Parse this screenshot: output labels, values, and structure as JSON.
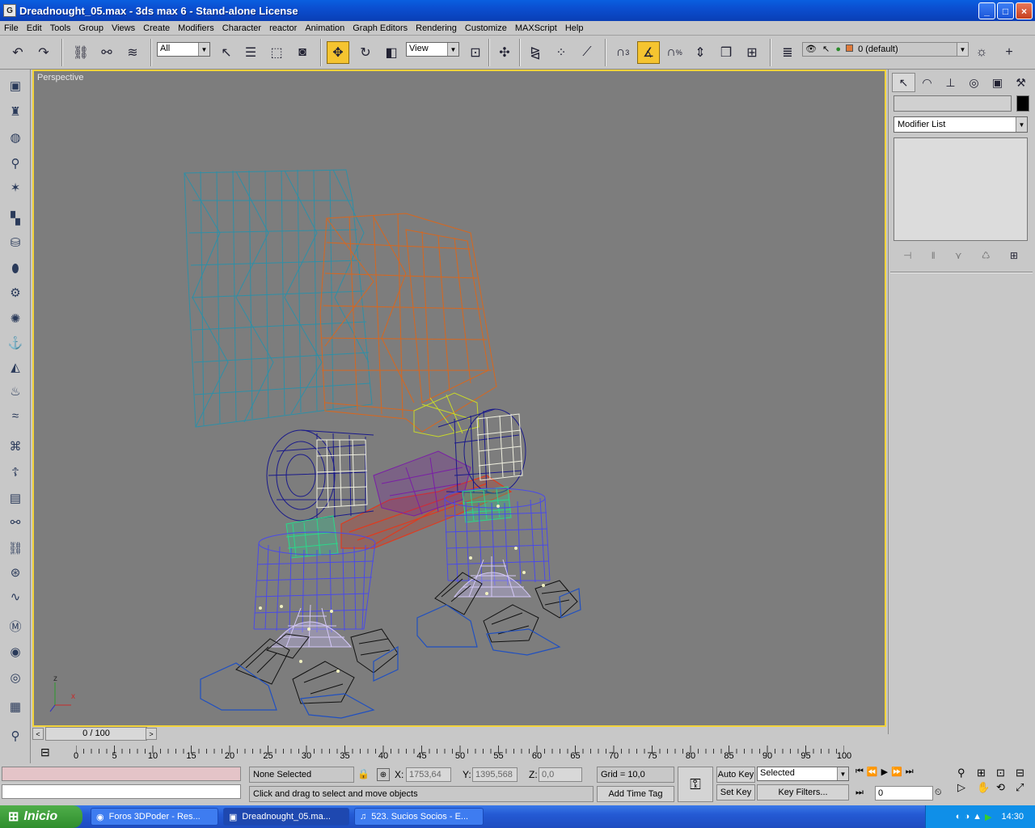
{
  "window": {
    "title": "Dreadnought_05.max - 3ds max 6 - Stand-alone License",
    "app_icon": "G",
    "minimize": "_",
    "maximize": "□",
    "close": "×"
  },
  "menu": [
    "File",
    "Edit",
    "Tools",
    "Group",
    "Views",
    "Create",
    "Modifiers",
    "Character",
    "reactor",
    "Animation",
    "Graph Editors",
    "Rendering",
    "Customize",
    "MAXScript",
    "Help"
  ],
  "toolbar": {
    "selection_filter": "All",
    "ref_coord": "View",
    "layer": "0 (default)",
    "snap_label": "3",
    "percent_label": "%"
  },
  "viewport": {
    "label": "Perspective",
    "axis_x": "x",
    "axis_z": "z"
  },
  "command_panel": {
    "modifier_list": "Modifier List",
    "swatch_color": "#000000"
  },
  "time_slider": {
    "frame": "0 / 100",
    "prev": "<",
    "next": ">"
  },
  "track": {
    "ticks": [
      "0",
      "5",
      "10",
      "15",
      "20",
      "25",
      "30",
      "35",
      "40",
      "45",
      "50",
      "55",
      "60",
      "65",
      "70",
      "75",
      "80",
      "85",
      "90",
      "95",
      "100"
    ]
  },
  "status": {
    "selection": "None Selected",
    "prompt": "Click and drag to select and move objects",
    "x_label": "X:",
    "x_value": "1753,64",
    "y_label": "Y:",
    "y_value": "1395,568",
    "z_label": "Z:",
    "z_value": "0,0",
    "grid": "Grid = 10,0",
    "add_time_tag": "Add Time Tag",
    "auto_key": "Auto Key",
    "set_key": "Set Key",
    "key_mode": "Selected",
    "key_filters": "Key Filters...",
    "frame_field": "0"
  },
  "taskbar": {
    "start": "Inicio",
    "items": [
      "Foros 3DPoder - Res...",
      "Dreadnought_05.ma...",
      "523. Sucios Socios - E..."
    ],
    "clock": "14:30"
  }
}
